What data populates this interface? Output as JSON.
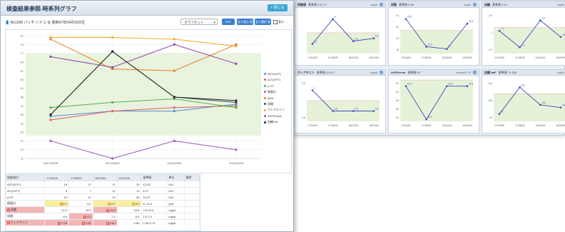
{
  "window": {
    "title": "検査結果参照‐時系列グラフ",
    "close_label": "× 閉じる"
  },
  "patient_info": "👤 No1000 パッチ ハナコ 女 昭和47年04月26日生",
  "graph_select": {
    "value": "‐グラフセット‐"
  },
  "buttons": {
    "print": "PDF",
    "btn_a": "全て表示 表示",
    "btn_b": "全て選択 表示"
  },
  "checkbox_label": "表示",
  "chart_data": {
    "type": "line",
    "x": [
      "2017/04/09",
      "2017/08/29",
      "2018/12/04",
      "2019/10/09"
    ],
    "ylim": [
      11,
      81
    ],
    "yticks": [
      11,
      16,
      21,
      26,
      31,
      36,
      41,
      46,
      51,
      56,
      61,
      66,
      71,
      76,
      81
    ],
    "normal_band": [
      24,
      71
    ],
    "grid": true,
    "legend_position": "right",
    "series": [
      {
        "name": "AST(GOT)",
        "color": "#4a90d9",
        "values": [
          35,
          38,
          38,
          42
        ]
      },
      {
        "name": "ALT(GPT)",
        "color": "#e05b5b",
        "values": [
          33,
          38,
          40,
          41
        ]
      },
      {
        "name": "γ-GT",
        "color": "#4caf50",
        "values": [
          40,
          43,
          45,
          40
        ]
      },
      {
        "name": "総蛋白",
        "color": "#9b59b6",
        "values": [
          21,
          11,
          21,
          16
        ]
      },
      {
        "name": "BUN",
        "color": "#e67e22",
        "values": [
          79,
          62,
          61,
          76
        ]
      },
      {
        "name": "尿酸",
        "color": "#34495e",
        "values": [
          36,
          72,
          46,
          43
        ]
      },
      {
        "name": "クレアチニン",
        "color": "#f5a623",
        "values": [
          80,
          80,
          79,
          75
        ]
      },
      {
        "name": "eGFRcreat",
        "color": "#8e44ad",
        "values": [
          69,
          63,
          76,
          65
        ]
      },
      {
        "name": "血糖 Na",
        "color": "#222222",
        "values": [
          36,
          72,
          46,
          44
        ]
      }
    ]
  },
  "table": {
    "headers": [
      "検査項目",
      "17/04/09",
      "17/08/29",
      "18/12/04",
      "19/10/09",
      "基準値",
      "単位",
      "備考"
    ],
    "rows": [
      {
        "cells": [
          [
            "AST(GOT)",
            "",
            ""
          ],
          [
            "16",
            "",
            ""
          ],
          [
            "17",
            "",
            ""
          ],
          [
            "17",
            "",
            ""
          ],
          [
            "29",
            "",
            ""
          ],
          [
            "13-33",
            "",
            ""
          ],
          [
            "IU/L",
            "",
            ""
          ],
          [
            "",
            "",
            ""
          ]
        ]
      },
      {
        "cells": [
          [
            "ALT(GPT)",
            "",
            ""
          ],
          [
            "8",
            "",
            ""
          ],
          [
            "7",
            "",
            ""
          ],
          [
            "11",
            "",
            ""
          ],
          [
            "11",
            "",
            ""
          ],
          [
            "6-27",
            "",
            ""
          ],
          [
            "IU/L",
            "",
            ""
          ],
          [
            "",
            "",
            ""
          ]
        ]
      },
      {
        "cells": [
          [
            "γ-GT",
            "",
            ""
          ],
          [
            "19",
            "",
            ""
          ],
          [
            "21",
            "",
            ""
          ],
          [
            "23",
            "",
            ""
          ],
          [
            "28",
            "",
            ""
          ],
          [
            "10-47",
            "",
            ""
          ],
          [
            "IU/L",
            "",
            ""
          ],
          [
            "",
            "",
            ""
          ]
        ]
      },
      {
        "cells": [
          [
            "総蛋白",
            "",
            ""
          ],
          [
            "6.7",
            "L",
            "l"
          ],
          [
            "8.1",
            "",
            ""
          ],
          [
            "6.7",
            "L",
            "l"
          ],
          [
            "6.3",
            "L",
            "l"
          ],
          [
            "6.7-8.3",
            "",
            ""
          ],
          [
            "g/dl",
            "",
            ""
          ],
          [
            "",
            "",
            ""
          ]
        ]
      },
      {
        "cells": [
          [
            "尿酸",
            "H",
            "h"
          ],
          [
            "20.0",
            "",
            ""
          ],
          [
            "19.0",
            "",
            ""
          ],
          [
            "19.6",
            "H",
            "h"
          ],
          [
            "29.6",
            "",
            ""
          ],
          [
            "3.5-22.0",
            "",
            ""
          ],
          [
            "mg/dl",
            "",
            ""
          ],
          [
            "",
            "",
            ""
          ]
        ]
      },
      {
        "cells": [
          [
            "尿酸",
            "",
            ""
          ],
          [
            "6.4",
            "",
            ""
          ],
          [
            "6.1",
            "H",
            "h"
          ],
          [
            "7.3",
            "",
            ""
          ],
          [
            "6.5",
            "",
            ""
          ],
          [
            "2.5-7.0",
            "",
            ""
          ],
          [
            "mg/dl",
            "",
            ""
          ],
          [
            "",
            "",
            ""
          ]
        ]
      },
      {
        "cells": [
          [
            "クレアチニン",
            "H",
            "h"
          ],
          [
            "0.90",
            "H",
            "h"
          ],
          [
            "0.82",
            "H",
            "h"
          ],
          [
            "0.80",
            "H",
            "h"
          ],
          [
            "0.80",
            "",
            ""
          ],
          [
            "0.40-0.79",
            "",
            ""
          ],
          [
            "mg/dl",
            "",
            ""
          ],
          [
            "",
            "",
            ""
          ]
        ]
      }
    ]
  },
  "bg_panels": [
    {
      "title": "尿酸値",
      "avg": "基準値 3.5-7.0",
      "unit": "mg/dl",
      "color": "#3a4bb5",
      "labels": [
        "17/04/09",
        "17/08/29",
        "18/12/04",
        "19/10/09"
      ],
      "yticks": [
        "",
        "",
        "",
        ""
      ],
      "values": [
        6.2,
        8.0,
        6.4,
        6.6
      ],
      "ylim": [
        5.5,
        8.5
      ],
      "band": [
        5.5,
        7.0
      ]
    },
    {
      "title": "尿酸",
      "avg": "基準値 5.55",
      "unit": "mg/dl",
      "color": "#3a4bb5",
      "labels": [
        "17/04/09",
        "17/08/29",
        "18/12/04",
        "19/10/09"
      ],
      "yticks": [
        "24",
        "22",
        "20",
        "18"
      ],
      "values": [
        23.5,
        17.5,
        17.0,
        22.5
      ],
      "ylim": [
        16,
        25
      ],
      "band": [
        16,
        21
      ]
    },
    {
      "title": "血糖",
      "avg": "基準値 2.5-7",
      "unit": "mg/dl",
      "color": "#3a4bb5",
      "labels": [
        "17/04/09",
        "17/08/29",
        "18/12/04",
        "19/10/09"
      ],
      "yticks": [
        "1.5",
        "1",
        "0.5"
      ],
      "values": [
        1.1,
        0.3,
        1.6,
        0.8
      ],
      "ylim": [
        0,
        2
      ],
      "band": [
        0,
        1.25
      ]
    },
    {
      "title": "クレアチニン",
      "avg": "基準値 0.4-0.7",
      "unit": "mg/dl",
      "color": "#3a4bb5",
      "labels": [
        "17/04/09",
        "17/08/29",
        "18/12/04",
        "19/10/09"
      ],
      "yticks": [
        "0.9",
        "0.8"
      ],
      "values": [
        1.0,
        0.8,
        0.8,
        0.8
      ],
      "ylim": [
        0.7,
        1.1
      ],
      "band": [
        0.7,
        0.9
      ]
    },
    {
      "title": "eGFRcreat",
      "avg": "基準値 60",
      "unit": "ml/min/1.73",
      "color": "#3a4bb5",
      "labels": [
        "17/04/09",
        "17/08/29",
        "18/12/04",
        "19/10/09"
      ],
      "yticks": [
        "62",
        "60",
        "58",
        "56",
        "54"
      ],
      "values": [
        61.5,
        53.5,
        61.5,
        61.5
      ],
      "ylim": [
        53,
        63
      ],
      "band": [
        53,
        63
      ]
    },
    {
      "title": "血糖 NaF",
      "avg": "基準値 70-100",
      "unit": "mg/dl",
      "color": "#3a4bb5",
      "labels": [
        "17/04/09",
        "17/08/29",
        "18/12/04",
        "19/10/09"
      ],
      "yticks": [
        "120",
        "100",
        "90"
      ],
      "values": [
        93,
        122,
        103,
        100
      ],
      "ylim": [
        85,
        130
      ],
      "band": [
        85,
        115
      ]
    }
  ]
}
